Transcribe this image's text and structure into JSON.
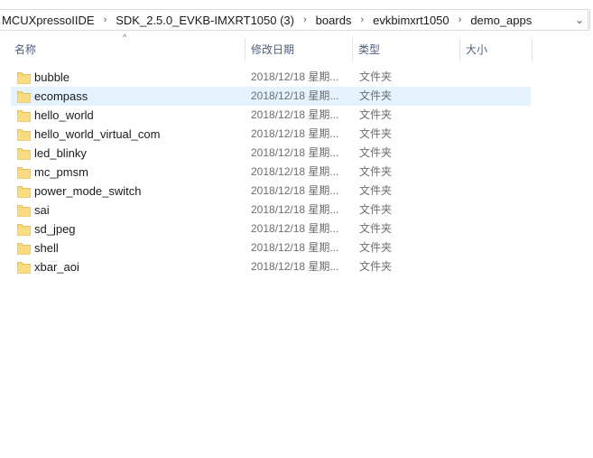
{
  "address_bar": {
    "crumbs": [
      "MCUXpressoIIDE",
      "SDK_2.5.0_EVKB-IMXRT1050 (3)",
      "boards",
      "evkbimxrt1050",
      "demo_apps"
    ],
    "separator": "›",
    "dropdown_glyph": "⌄"
  },
  "header": {
    "sort_glyph": "^",
    "name": "名称",
    "date": "修改日期",
    "type": "类型",
    "size": "大小"
  },
  "files": [
    {
      "name": "bubble",
      "date": "2018/12/18 星期...",
      "type": "文件夹",
      "selected": false
    },
    {
      "name": "ecompass",
      "date": "2018/12/18 星期...",
      "type": "文件夹",
      "selected": true
    },
    {
      "name": "hello_world",
      "date": "2018/12/18 星期...",
      "type": "文件夹",
      "selected": false
    },
    {
      "name": "hello_world_virtual_com",
      "date": "2018/12/18 星期...",
      "type": "文件夹",
      "selected": false
    },
    {
      "name": "led_blinky",
      "date": "2018/12/18 星期...",
      "type": "文件夹",
      "selected": false
    },
    {
      "name": "mc_pmsm",
      "date": "2018/12/18 星期...",
      "type": "文件夹",
      "selected": false
    },
    {
      "name": "power_mode_switch",
      "date": "2018/12/18 星期...",
      "type": "文件夹",
      "selected": false
    },
    {
      "name": "sai",
      "date": "2018/12/18 星期...",
      "type": "文件夹",
      "selected": false
    },
    {
      "name": "sd_jpeg",
      "date": "2018/12/18 星期...",
      "type": "文件夹",
      "selected": false
    },
    {
      "name": "shell",
      "date": "2018/12/18 星期...",
      "type": "文件夹",
      "selected": false
    },
    {
      "name": "xbar_aoi",
      "date": "2018/12/18 星期...",
      "type": "文件夹",
      "selected": false
    }
  ],
  "colors": {
    "selected_row": "#e5f3ff",
    "folder": "#f8d775",
    "header_text": "#4c607a"
  }
}
